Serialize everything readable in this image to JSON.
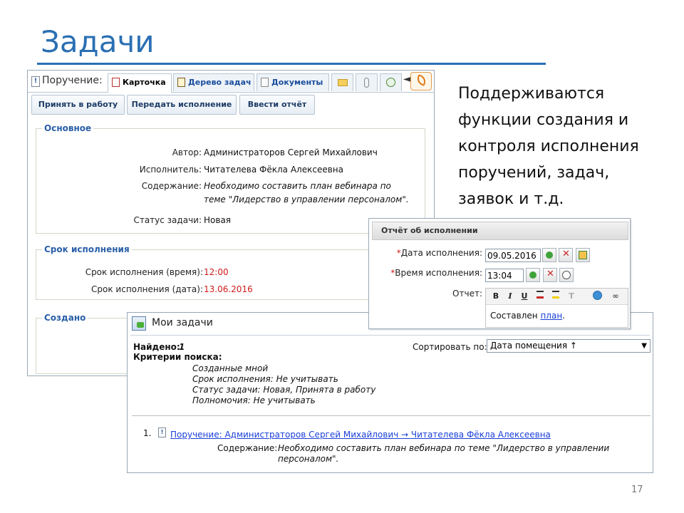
{
  "slide": {
    "title": "Задачи",
    "text_lines": [
      "Поддерживаются",
      "функции создания и",
      "контроля исполнения",
      "поручений, задач,",
      "заявок и т.д."
    ],
    "page_number": "17"
  },
  "task_window": {
    "header_label": "Поручение:",
    "tabs": [
      {
        "label": "Карточка",
        "icon": "card-icon"
      },
      {
        "label": "Дерево задач",
        "icon": "task-tree-icon"
      },
      {
        "label": "Документы",
        "icon": "documents-icon"
      }
    ],
    "toolbar": {
      "accept": "Принять в работу",
      "transfer": "Передать исполнение",
      "report": "Ввести отчёт"
    },
    "main_section": {
      "legend": "Основное",
      "author_label": "Автор:",
      "author": "Администраторов Сергей Михайлович",
      "executor_label": "Исполнитель:",
      "executor": "Читателева Фёкла Алексеевна",
      "content_label": "Содержание:",
      "content_line1": "Необходимо составить план вебинара по",
      "content_line2": "теме \"Лидерство в управлении персоналом\".",
      "status_label": "Статус задачи:",
      "status": "Новая"
    },
    "deadline_section": {
      "legend": "Срок исполнения",
      "time_label": "Срок исполнения (время):",
      "time": "12:00",
      "date_label": "Срок исполнения (дата):",
      "date": "13.06.2016"
    },
    "created_section": {
      "legend": "Создано"
    }
  },
  "report_window": {
    "title": "Отчёт об исполнении",
    "date_label": "Дата исполнения:",
    "date_value": "09.05.2016",
    "time_label": "Время исполнения:",
    "time_value": "13:04",
    "report_label": "Отчет:",
    "required_mark": "*",
    "editor": {
      "bold": "B",
      "italic": "I",
      "underline": "U",
      "text_before": "Составлен ",
      "link_text": "план",
      "text_after": "."
    }
  },
  "mytasks_window": {
    "title": "Мои задачи",
    "found_label": "Найдено:",
    "found_count": "1",
    "criteria_label": "Критерии поиска:",
    "criteria": [
      "Созданные мной",
      "Срок исполнения: Не учитывать",
      "Статус задачи: Новая, Принята в работу",
      "Полномочия: Не учитывать"
    ],
    "sort_label": "Сортировать по:",
    "sort_value": "Дата помещения ↑",
    "result_index": "1.",
    "result_link": "Поручение: Администраторов Сергей Михайлович → Читателева Фёкла Алексеевна",
    "result_content_label": "Содержание:",
    "result_content_line1": "Необходимо составить план вебинара по теме \"Лидерство в управлении",
    "result_content_line2": "персоналом\"."
  },
  "colors": {
    "accent": "#2a6fb3",
    "link": "#1a3fd8",
    "deadline": "#d01a1a"
  }
}
